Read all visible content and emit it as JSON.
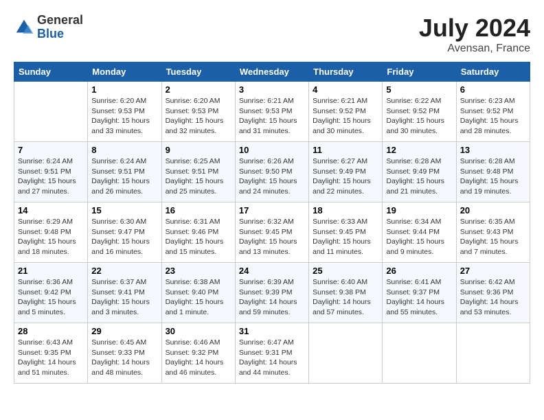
{
  "header": {
    "logo": {
      "general": "General",
      "blue": "Blue"
    },
    "title": "July 2024",
    "location": "Avensan, France"
  },
  "columns": [
    "Sunday",
    "Monday",
    "Tuesday",
    "Wednesday",
    "Thursday",
    "Friday",
    "Saturday"
  ],
  "weeks": [
    [
      {
        "day": "",
        "sunrise": "",
        "sunset": "",
        "daylight": ""
      },
      {
        "day": "1",
        "sunrise": "Sunrise: 6:20 AM",
        "sunset": "Sunset: 9:53 PM",
        "daylight": "Daylight: 15 hours and 33 minutes."
      },
      {
        "day": "2",
        "sunrise": "Sunrise: 6:20 AM",
        "sunset": "Sunset: 9:53 PM",
        "daylight": "Daylight: 15 hours and 32 minutes."
      },
      {
        "day": "3",
        "sunrise": "Sunrise: 6:21 AM",
        "sunset": "Sunset: 9:53 PM",
        "daylight": "Daylight: 15 hours and 31 minutes."
      },
      {
        "day": "4",
        "sunrise": "Sunrise: 6:21 AM",
        "sunset": "Sunset: 9:52 PM",
        "daylight": "Daylight: 15 hours and 30 minutes."
      },
      {
        "day": "5",
        "sunrise": "Sunrise: 6:22 AM",
        "sunset": "Sunset: 9:52 PM",
        "daylight": "Daylight: 15 hours and 30 minutes."
      },
      {
        "day": "6",
        "sunrise": "Sunrise: 6:23 AM",
        "sunset": "Sunset: 9:52 PM",
        "daylight": "Daylight: 15 hours and 28 minutes."
      }
    ],
    [
      {
        "day": "7",
        "sunrise": "Sunrise: 6:24 AM",
        "sunset": "Sunset: 9:51 PM",
        "daylight": "Daylight: 15 hours and 27 minutes."
      },
      {
        "day": "8",
        "sunrise": "Sunrise: 6:24 AM",
        "sunset": "Sunset: 9:51 PM",
        "daylight": "Daylight: 15 hours and 26 minutes."
      },
      {
        "day": "9",
        "sunrise": "Sunrise: 6:25 AM",
        "sunset": "Sunset: 9:51 PM",
        "daylight": "Daylight: 15 hours and 25 minutes."
      },
      {
        "day": "10",
        "sunrise": "Sunrise: 6:26 AM",
        "sunset": "Sunset: 9:50 PM",
        "daylight": "Daylight: 15 hours and 24 minutes."
      },
      {
        "day": "11",
        "sunrise": "Sunrise: 6:27 AM",
        "sunset": "Sunset: 9:49 PM",
        "daylight": "Daylight: 15 hours and 22 minutes."
      },
      {
        "day": "12",
        "sunrise": "Sunrise: 6:28 AM",
        "sunset": "Sunset: 9:49 PM",
        "daylight": "Daylight: 15 hours and 21 minutes."
      },
      {
        "day": "13",
        "sunrise": "Sunrise: 6:28 AM",
        "sunset": "Sunset: 9:48 PM",
        "daylight": "Daylight: 15 hours and 19 minutes."
      }
    ],
    [
      {
        "day": "14",
        "sunrise": "Sunrise: 6:29 AM",
        "sunset": "Sunset: 9:48 PM",
        "daylight": "Daylight: 15 hours and 18 minutes."
      },
      {
        "day": "15",
        "sunrise": "Sunrise: 6:30 AM",
        "sunset": "Sunset: 9:47 PM",
        "daylight": "Daylight: 15 hours and 16 minutes."
      },
      {
        "day": "16",
        "sunrise": "Sunrise: 6:31 AM",
        "sunset": "Sunset: 9:46 PM",
        "daylight": "Daylight: 15 hours and 15 minutes."
      },
      {
        "day": "17",
        "sunrise": "Sunrise: 6:32 AM",
        "sunset": "Sunset: 9:45 PM",
        "daylight": "Daylight: 15 hours and 13 minutes."
      },
      {
        "day": "18",
        "sunrise": "Sunrise: 6:33 AM",
        "sunset": "Sunset: 9:45 PM",
        "daylight": "Daylight: 15 hours and 11 minutes."
      },
      {
        "day": "19",
        "sunrise": "Sunrise: 6:34 AM",
        "sunset": "Sunset: 9:44 PM",
        "daylight": "Daylight: 15 hours and 9 minutes."
      },
      {
        "day": "20",
        "sunrise": "Sunrise: 6:35 AM",
        "sunset": "Sunset: 9:43 PM",
        "daylight": "Daylight: 15 hours and 7 minutes."
      }
    ],
    [
      {
        "day": "21",
        "sunrise": "Sunrise: 6:36 AM",
        "sunset": "Sunset: 9:42 PM",
        "daylight": "Daylight: 15 hours and 5 minutes."
      },
      {
        "day": "22",
        "sunrise": "Sunrise: 6:37 AM",
        "sunset": "Sunset: 9:41 PM",
        "daylight": "Daylight: 15 hours and 3 minutes."
      },
      {
        "day": "23",
        "sunrise": "Sunrise: 6:38 AM",
        "sunset": "Sunset: 9:40 PM",
        "daylight": "Daylight: 15 hours and 1 minute."
      },
      {
        "day": "24",
        "sunrise": "Sunrise: 6:39 AM",
        "sunset": "Sunset: 9:39 PM",
        "daylight": "Daylight: 14 hours and 59 minutes."
      },
      {
        "day": "25",
        "sunrise": "Sunrise: 6:40 AM",
        "sunset": "Sunset: 9:38 PM",
        "daylight": "Daylight: 14 hours and 57 minutes."
      },
      {
        "day": "26",
        "sunrise": "Sunrise: 6:41 AM",
        "sunset": "Sunset: 9:37 PM",
        "daylight": "Daylight: 14 hours and 55 minutes."
      },
      {
        "day": "27",
        "sunrise": "Sunrise: 6:42 AM",
        "sunset": "Sunset: 9:36 PM",
        "daylight": "Daylight: 14 hours and 53 minutes."
      }
    ],
    [
      {
        "day": "28",
        "sunrise": "Sunrise: 6:43 AM",
        "sunset": "Sunset: 9:35 PM",
        "daylight": "Daylight: 14 hours and 51 minutes."
      },
      {
        "day": "29",
        "sunrise": "Sunrise: 6:45 AM",
        "sunset": "Sunset: 9:33 PM",
        "daylight": "Daylight: 14 hours and 48 minutes."
      },
      {
        "day": "30",
        "sunrise": "Sunrise: 6:46 AM",
        "sunset": "Sunset: 9:32 PM",
        "daylight": "Daylight: 14 hours and 46 minutes."
      },
      {
        "day": "31",
        "sunrise": "Sunrise: 6:47 AM",
        "sunset": "Sunset: 9:31 PM",
        "daylight": "Daylight: 14 hours and 44 minutes."
      },
      {
        "day": "",
        "sunrise": "",
        "sunset": "",
        "daylight": ""
      },
      {
        "day": "",
        "sunrise": "",
        "sunset": "",
        "daylight": ""
      },
      {
        "day": "",
        "sunrise": "",
        "sunset": "",
        "daylight": ""
      }
    ]
  ]
}
